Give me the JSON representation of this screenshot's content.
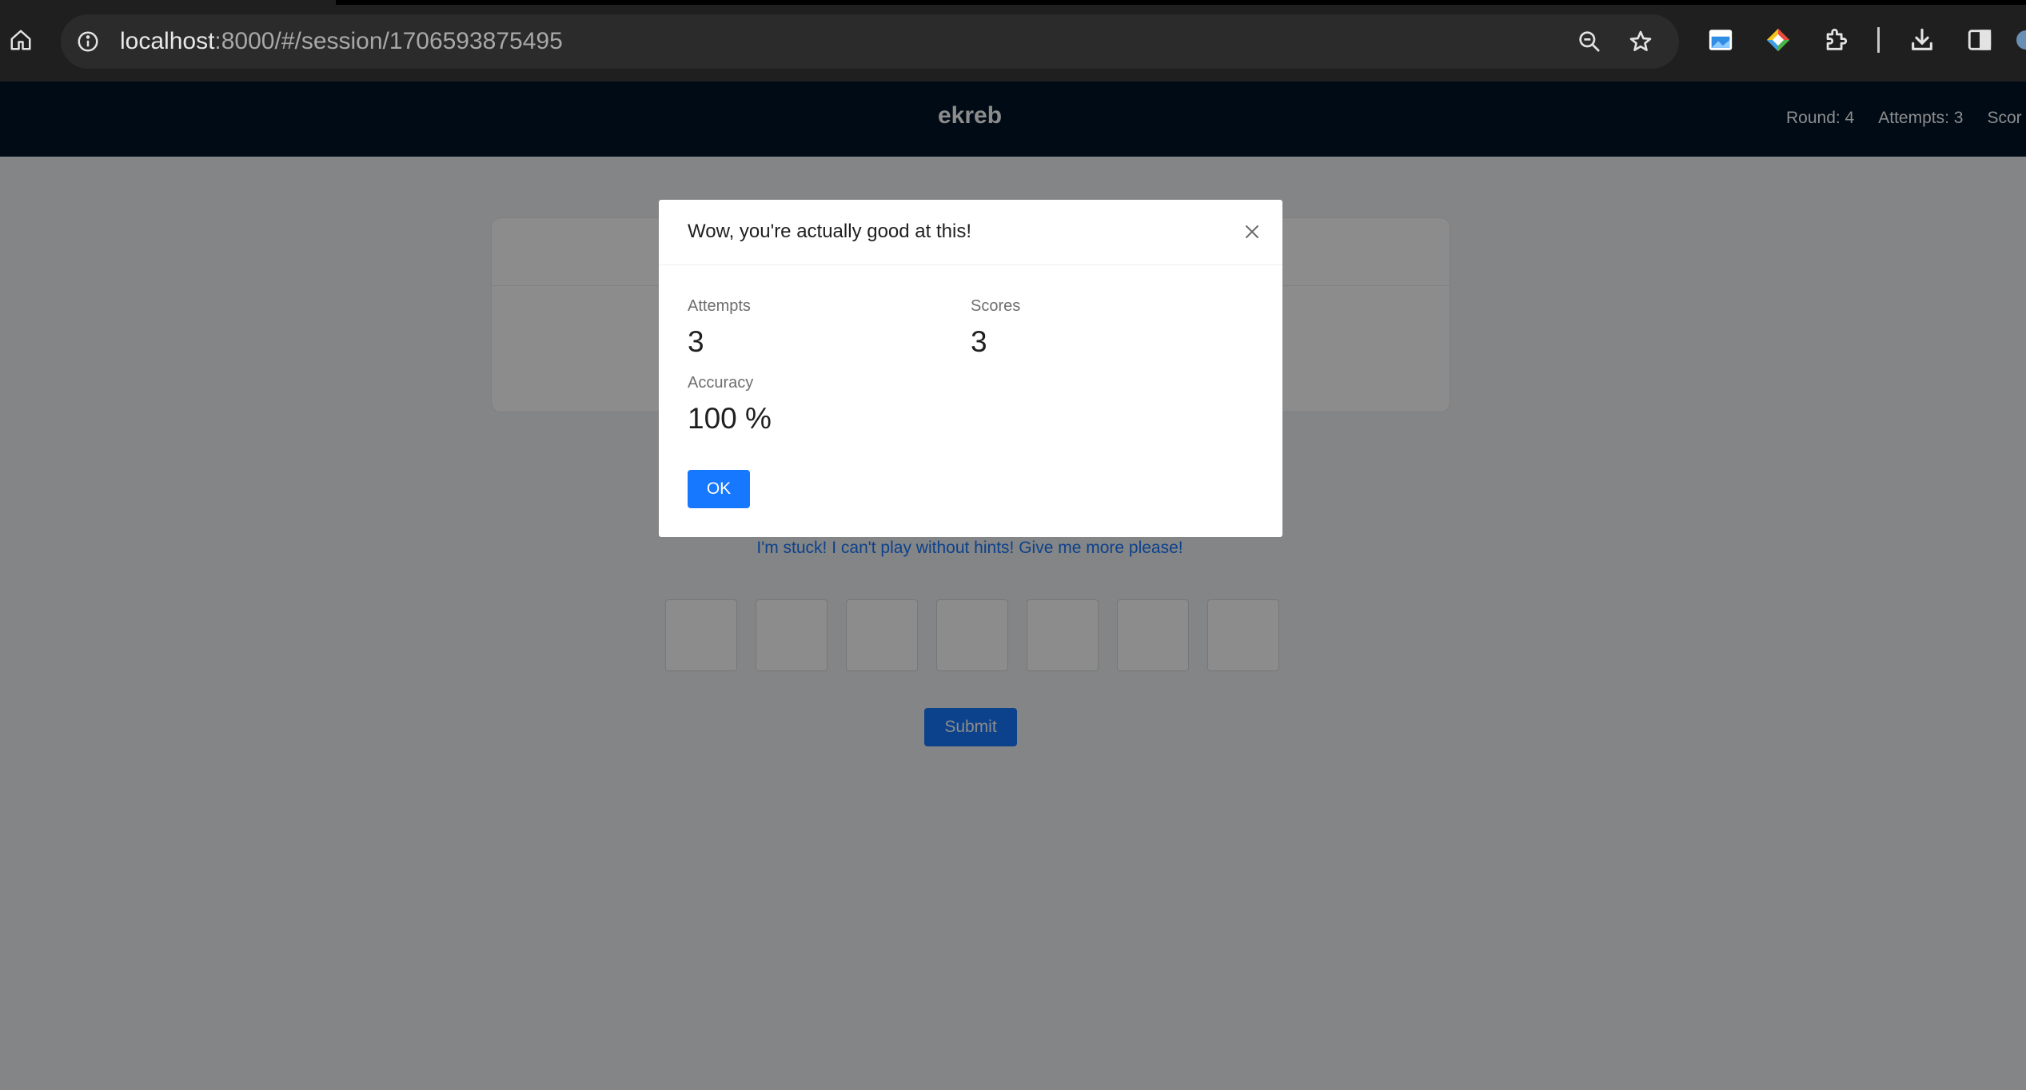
{
  "browser": {
    "url_host": "localhost",
    "url_path": ":8000/#/session/1706593875495",
    "icons": [
      "home-icon",
      "site-info-icon",
      "zoom-icon",
      "bookmark-star-icon",
      "extension-tile-icon",
      "extension-diamond-icon",
      "puzzle-icon",
      "download-icon",
      "side-panel-icon"
    ]
  },
  "app": {
    "title": "ekreb",
    "stats": {
      "round": "Round: 4",
      "attempts": "Attempts: 3",
      "score": "Scor"
    },
    "hint_link": "I'm stuck! I can't play without hints! Give me more please!",
    "letter_box_count": 7,
    "submit_label": "Submit"
  },
  "modal": {
    "title": "Wow, you're actually good at this!",
    "attempts_label": "Attempts",
    "attempts_value": "3",
    "scores_label": "Scores",
    "scores_value": "3",
    "accuracy_label": "Accuracy",
    "accuracy_value": "100 %",
    "ok_label": "OK"
  },
  "colors": {
    "header_bg": "#001529",
    "primary": "#1677ff",
    "browser_bg": "#1f1f1f"
  }
}
